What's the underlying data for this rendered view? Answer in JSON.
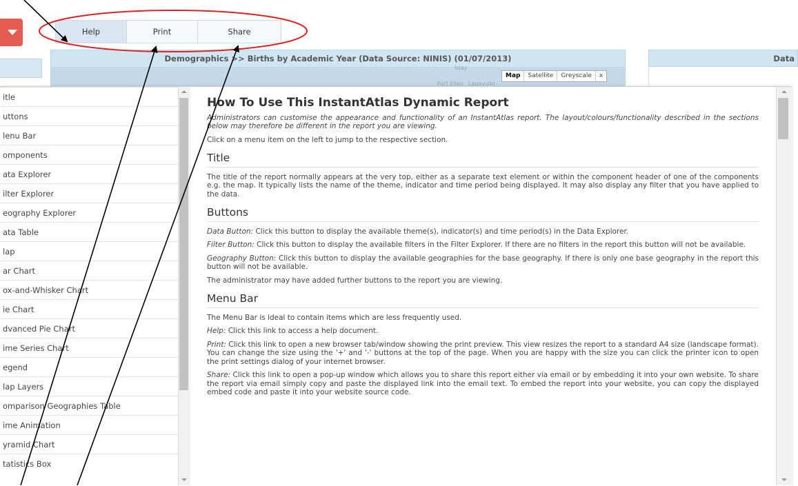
{
  "menu": {
    "help": "Help",
    "print": "Print",
    "share": "Share"
  },
  "header": {
    "title": "Demographics >> Births by Academic Year (Data Source: NINIS) (01/07/2013)",
    "right_title": "Data"
  },
  "map": {
    "controls": [
      "Map",
      "Satellite",
      "Greyscale",
      "x"
    ],
    "labels": [
      "Islay",
      "Port Ellen",
      "Lagavulin"
    ]
  },
  "toc": [
    "itle",
    "uttons",
    "lenu Bar",
    "omponents",
    "ata Explorer",
    "ilter Explorer",
    "eography Explorer",
    "ata Table",
    "lap",
    "ar Chart",
    "ox-and-Whisker Chart",
    "ie Chart",
    "dvanced Pie Chart",
    "ime Series Chart",
    "egend",
    "lap Layers",
    "omparison Geographies Table",
    "ime Animation",
    "yramid Chart",
    "tatistics Box"
  ],
  "content": {
    "title": "How To Use This InstantAtlas Dynamic Report",
    "intro": "Administrators can customise the appearance and functionality of an InstantAtlas report. The layout/colours/functionality described in the sections below may therefore be different in the report you are viewing.",
    "click": "Click on a menu item on the left to jump to the respective section.",
    "title_heading": "Title",
    "title_text": "The title of the report normally appears at the very top, either as a separate text element or within the component header of one of the components e.g. the map. It typically lists the name of the theme, indicator and time period being displayed. It may also display any filter that you have applied to the data.",
    "buttons_heading": "Buttons",
    "data_btn_label": "Data Button:",
    "data_btn_text": " Click this button to display the available theme(s), indicator(s) and time period(s) in the Data Explorer.",
    "filter_btn_label": "Filter Button:",
    "filter_btn_text": " Click this button to display the available filters in the Filter Explorer. If there are no filters in the report this button will not be available.",
    "geo_btn_label": "Geography Button:",
    "geo_btn_text": " Click this button to display the available geographies for the base geography. If there is only one base geography in the report this button will not be available.",
    "admin_text": "The administrator may have added further buttons to the report you are viewing.",
    "menubar_heading": "Menu Bar",
    "menubar_text": "The Menu Bar is ideal to contain items which are less frequently used.",
    "help_label": "Help:",
    "help_text": " Click this link to access a help document.",
    "print_label": "Print:",
    "print_text": " Click this link to open a new browser tab/window showing the print preview. This view resizes the report to a standard A4 size (landscape format). You can change the size using the '+' and '-' buttons at the top of the page. When you are happy with the size you can click the printer icon to open the print settings dialog of your internet browser.",
    "share_label": "Share:",
    "share_text": " Click this link to open a pop-up window which allows you to share this report either via email or by embedding it into your own website. To share the report via email simply copy and paste the displayed link into the email text. To embed the report into your website, you can copy the displayed embed code and paste it into your website source code."
  },
  "colors": {
    "annotation": "#e02020",
    "accent_red": "#e45b4f",
    "header_blue": "#cfe5f2"
  }
}
